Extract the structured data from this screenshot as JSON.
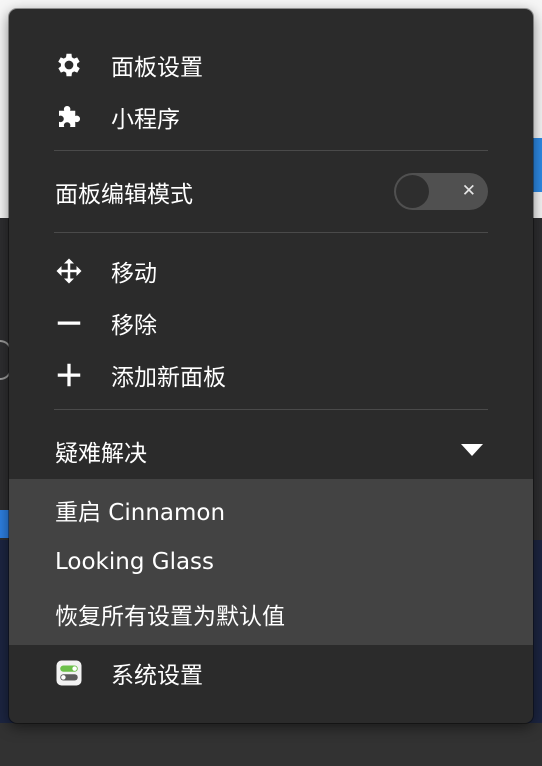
{
  "menu": {
    "panel_settings": "面板设置",
    "applets": "小程序",
    "panel_edit_mode": "面板编辑模式",
    "move": "移动",
    "remove": "移除",
    "add_new_panel": "添加新面板",
    "troubleshoot": "疑难解决",
    "system_settings": "系统设置"
  },
  "toggle": {
    "state": "off",
    "off_glyph": "✕"
  },
  "troubleshoot_submenu": {
    "restart_cinnamon": "重启 Cinnamon",
    "looking_glass": "Looking Glass",
    "restore_defaults": "恢复所有设置为默认值"
  },
  "icons": {
    "panel_settings": "gear-icon",
    "applets": "puzzle-icon",
    "move": "move-arrows-icon",
    "remove": "minus-icon",
    "add": "plus-icon",
    "expand": "triangle-down-icon",
    "system_settings": "system-settings-icon"
  },
  "colors": {
    "menu_bg": "#2b2b2b",
    "submenu_bg": "#434343",
    "separator": "#4a4a4a",
    "toggle_track": "#505050",
    "settings_icon_green": "#6cc04a"
  }
}
